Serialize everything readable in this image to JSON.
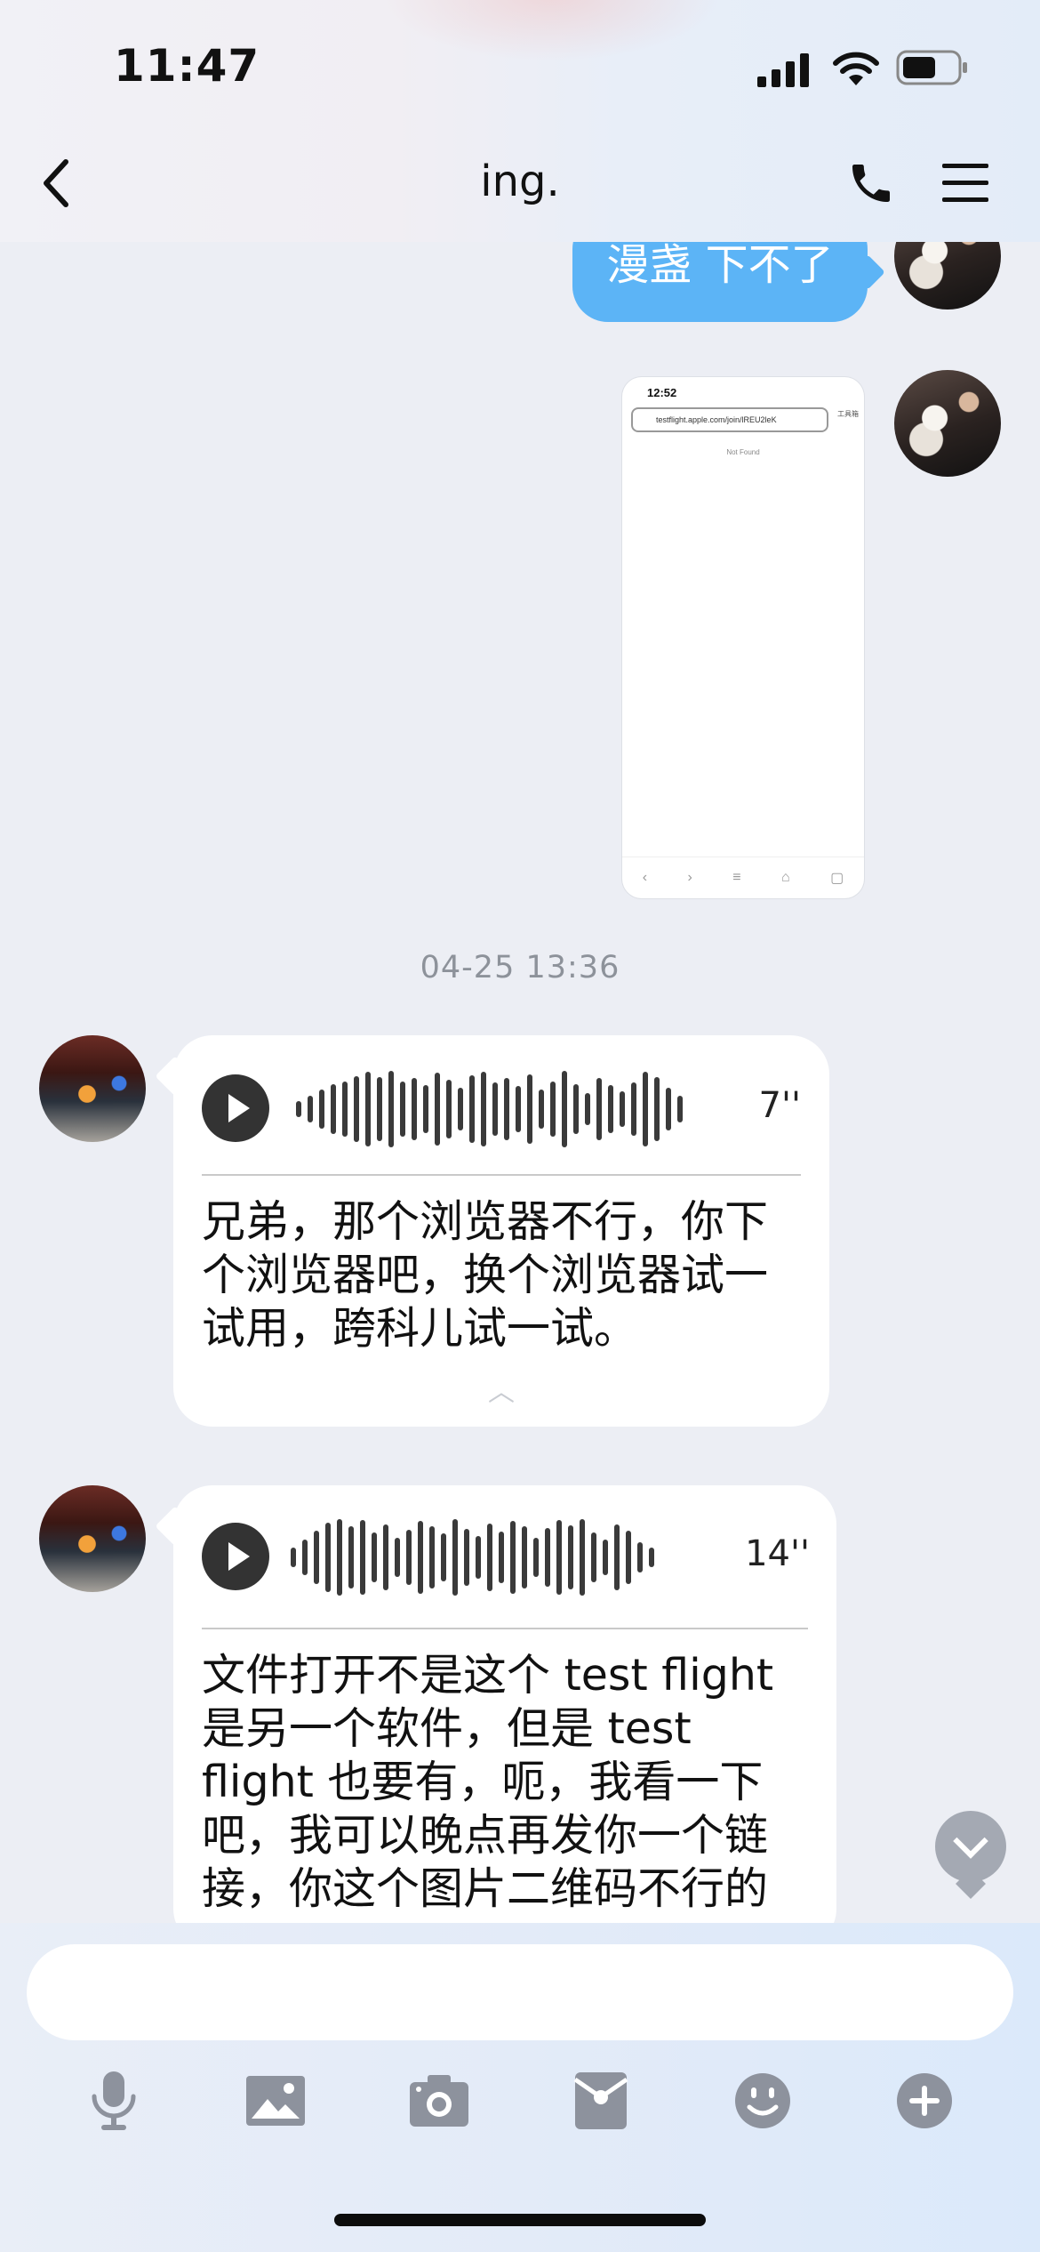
{
  "status_bar": {
    "time": "11:47"
  },
  "header": {
    "title": "ing."
  },
  "messages": {
    "sent_text": "漫盏 下不了",
    "screenshot": {
      "time": "12:52",
      "url": "testflight.apple.com/join/lREU2leK",
      "tool_label": "工具箱",
      "not_found": "Not Found"
    },
    "date_divider": "04-25 13:36",
    "voice1": {
      "duration": "7''",
      "transcript": "兄弟，那个浏览器不行，你下个浏览器吧，换个浏览器试一试用，跨科儿试一试。"
    },
    "voice2": {
      "duration": "14''",
      "transcript": "文件打开不是这个 test flight 是另一个软件，但是 test flight 也要有，呃，我看一下吧，我可以晚点再发你一个链接，你这个图片二维码不行的"
    }
  },
  "composer": {
    "input_value": ""
  },
  "colors": {
    "sent_bubble": "#5cb4f6",
    "icon_gray": "#8d929d"
  }
}
